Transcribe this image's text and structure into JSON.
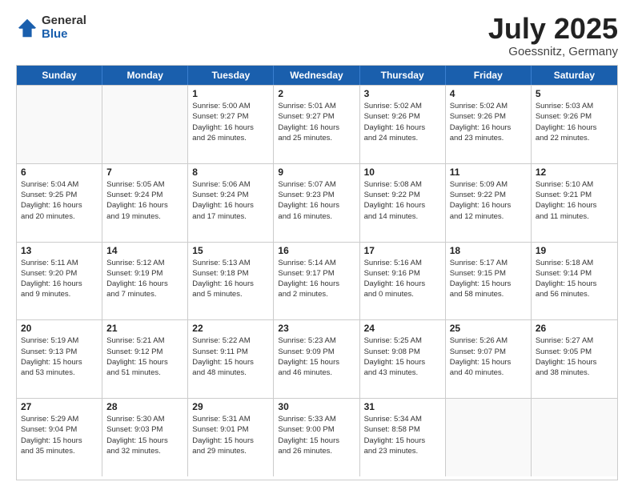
{
  "header": {
    "logo_general": "General",
    "logo_blue": "Blue",
    "month_year": "July 2025",
    "location": "Goessnitz, Germany"
  },
  "weekdays": [
    "Sunday",
    "Monday",
    "Tuesday",
    "Wednesday",
    "Thursday",
    "Friday",
    "Saturday"
  ],
  "rows": [
    [
      {
        "day": "",
        "info": ""
      },
      {
        "day": "",
        "info": ""
      },
      {
        "day": "1",
        "info": "Sunrise: 5:00 AM\nSunset: 9:27 PM\nDaylight: 16 hours\nand 26 minutes."
      },
      {
        "day": "2",
        "info": "Sunrise: 5:01 AM\nSunset: 9:27 PM\nDaylight: 16 hours\nand 25 minutes."
      },
      {
        "day": "3",
        "info": "Sunrise: 5:02 AM\nSunset: 9:26 PM\nDaylight: 16 hours\nand 24 minutes."
      },
      {
        "day": "4",
        "info": "Sunrise: 5:02 AM\nSunset: 9:26 PM\nDaylight: 16 hours\nand 23 minutes."
      },
      {
        "day": "5",
        "info": "Sunrise: 5:03 AM\nSunset: 9:26 PM\nDaylight: 16 hours\nand 22 minutes."
      }
    ],
    [
      {
        "day": "6",
        "info": "Sunrise: 5:04 AM\nSunset: 9:25 PM\nDaylight: 16 hours\nand 20 minutes."
      },
      {
        "day": "7",
        "info": "Sunrise: 5:05 AM\nSunset: 9:24 PM\nDaylight: 16 hours\nand 19 minutes."
      },
      {
        "day": "8",
        "info": "Sunrise: 5:06 AM\nSunset: 9:24 PM\nDaylight: 16 hours\nand 17 minutes."
      },
      {
        "day": "9",
        "info": "Sunrise: 5:07 AM\nSunset: 9:23 PM\nDaylight: 16 hours\nand 16 minutes."
      },
      {
        "day": "10",
        "info": "Sunrise: 5:08 AM\nSunset: 9:22 PM\nDaylight: 16 hours\nand 14 minutes."
      },
      {
        "day": "11",
        "info": "Sunrise: 5:09 AM\nSunset: 9:22 PM\nDaylight: 16 hours\nand 12 minutes."
      },
      {
        "day": "12",
        "info": "Sunrise: 5:10 AM\nSunset: 9:21 PM\nDaylight: 16 hours\nand 11 minutes."
      }
    ],
    [
      {
        "day": "13",
        "info": "Sunrise: 5:11 AM\nSunset: 9:20 PM\nDaylight: 16 hours\nand 9 minutes."
      },
      {
        "day": "14",
        "info": "Sunrise: 5:12 AM\nSunset: 9:19 PM\nDaylight: 16 hours\nand 7 minutes."
      },
      {
        "day": "15",
        "info": "Sunrise: 5:13 AM\nSunset: 9:18 PM\nDaylight: 16 hours\nand 5 minutes."
      },
      {
        "day": "16",
        "info": "Sunrise: 5:14 AM\nSunset: 9:17 PM\nDaylight: 16 hours\nand 2 minutes."
      },
      {
        "day": "17",
        "info": "Sunrise: 5:16 AM\nSunset: 9:16 PM\nDaylight: 16 hours\nand 0 minutes."
      },
      {
        "day": "18",
        "info": "Sunrise: 5:17 AM\nSunset: 9:15 PM\nDaylight: 15 hours\nand 58 minutes."
      },
      {
        "day": "19",
        "info": "Sunrise: 5:18 AM\nSunset: 9:14 PM\nDaylight: 15 hours\nand 56 minutes."
      }
    ],
    [
      {
        "day": "20",
        "info": "Sunrise: 5:19 AM\nSunset: 9:13 PM\nDaylight: 15 hours\nand 53 minutes."
      },
      {
        "day": "21",
        "info": "Sunrise: 5:21 AM\nSunset: 9:12 PM\nDaylight: 15 hours\nand 51 minutes."
      },
      {
        "day": "22",
        "info": "Sunrise: 5:22 AM\nSunset: 9:11 PM\nDaylight: 15 hours\nand 48 minutes."
      },
      {
        "day": "23",
        "info": "Sunrise: 5:23 AM\nSunset: 9:09 PM\nDaylight: 15 hours\nand 46 minutes."
      },
      {
        "day": "24",
        "info": "Sunrise: 5:25 AM\nSunset: 9:08 PM\nDaylight: 15 hours\nand 43 minutes."
      },
      {
        "day": "25",
        "info": "Sunrise: 5:26 AM\nSunset: 9:07 PM\nDaylight: 15 hours\nand 40 minutes."
      },
      {
        "day": "26",
        "info": "Sunrise: 5:27 AM\nSunset: 9:05 PM\nDaylight: 15 hours\nand 38 minutes."
      }
    ],
    [
      {
        "day": "27",
        "info": "Sunrise: 5:29 AM\nSunset: 9:04 PM\nDaylight: 15 hours\nand 35 minutes."
      },
      {
        "day": "28",
        "info": "Sunrise: 5:30 AM\nSunset: 9:03 PM\nDaylight: 15 hours\nand 32 minutes."
      },
      {
        "day": "29",
        "info": "Sunrise: 5:31 AM\nSunset: 9:01 PM\nDaylight: 15 hours\nand 29 minutes."
      },
      {
        "day": "30",
        "info": "Sunrise: 5:33 AM\nSunset: 9:00 PM\nDaylight: 15 hours\nand 26 minutes."
      },
      {
        "day": "31",
        "info": "Sunrise: 5:34 AM\nSunset: 8:58 PM\nDaylight: 15 hours\nand 23 minutes."
      },
      {
        "day": "",
        "info": ""
      },
      {
        "day": "",
        "info": ""
      }
    ]
  ]
}
